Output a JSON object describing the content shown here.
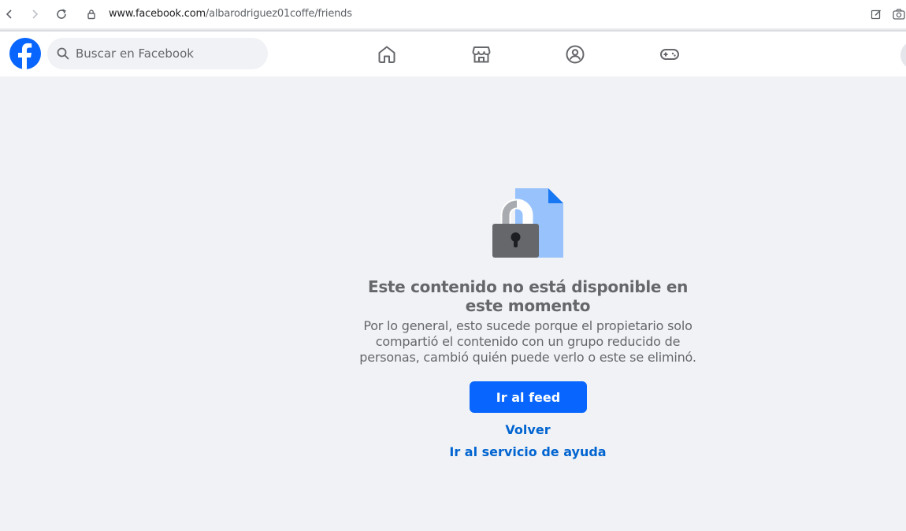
{
  "browser": {
    "url_host": "www.facebook.com",
    "url_path": "/albarodriguez01coffe/friends",
    "icons": [
      "back-icon",
      "forward-icon",
      "reload-icon",
      "lock-icon",
      "edit-icon",
      "camera-icon"
    ]
  },
  "header": {
    "search_placeholder": "Buscar en Facebook",
    "nav_icons": [
      "home-icon",
      "marketplace-icon",
      "groups-icon",
      "gaming-icon"
    ],
    "brand_color": "#0866ff"
  },
  "main": {
    "title": "Este contenido no está disponible en este momento",
    "description": "Por lo general, esto sucede porque el propietario solo compartió el contenido con un grupo reducido de personas, cambió quién puede verlo o este se eliminó.",
    "primary_button": "Ir al feed",
    "back_link": "Volver",
    "help_link": "Ir al servicio de ayuda",
    "accent_color": "#0866ff",
    "link_color": "#0064d1"
  }
}
